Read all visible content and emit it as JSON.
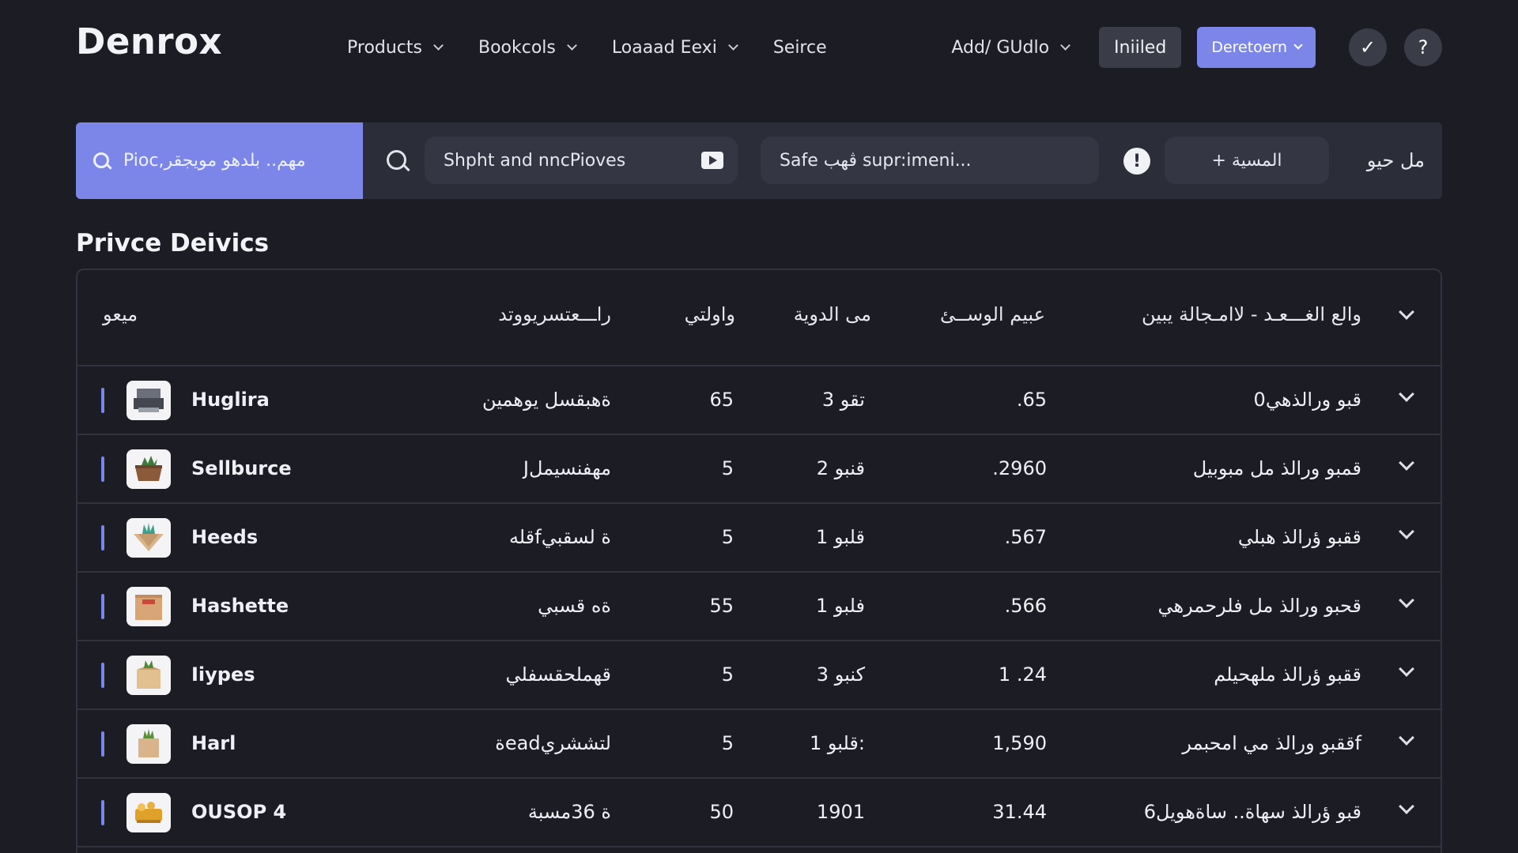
{
  "app": {
    "logo": "Denrox"
  },
  "nav": {
    "items": [
      {
        "label": "Products",
        "has_menu": true
      },
      {
        "label": "Bookcols",
        "has_menu": true
      },
      {
        "label": "Loaaad Eexi",
        "has_menu": true
      },
      {
        "label": "Seirce",
        "has_menu": false
      }
    ],
    "add_guide": "Add/ GUdlo",
    "inlined_button": "Iniiled",
    "deretoern_button": "Deretoern"
  },
  "search": {
    "primary_placeholder": "Pioc,مهم.. بلدهو مويجقر",
    "pill1_text": "Shpht and nncPioves",
    "pill2_text": "Safe ڤهب supr:imeni...",
    "alert_glyph": "!",
    "pill3_text": "المسية +",
    "right_text": "مل حيو"
  },
  "section": {
    "title": "Privce Deivics"
  },
  "table": {
    "headers": {
      "name": "ميعو",
      "desc": "راـــعتسريووتد",
      "qty": "واولتي",
      "group": "مى الدوية",
      "price": "عبيم الوســئ",
      "detail": "والع الغـــعـد - لاامـجالة يبين"
    },
    "rows": [
      {
        "name": "Huglira",
        "desc": "ةهبقسل يوهمين",
        "qty": "65",
        "group": "تقو 3",
        "price": ".65",
        "detail": "0قبو ورالذهي"
      },
      {
        "name": "Sellburce",
        "desc": "Jمهفنسيمل",
        "qty": "5",
        "group": "قنبو 2",
        "price": ".2960",
        "detail": "قمبو ورالذ مل مبوبيل"
      },
      {
        "name": "Heeds",
        "desc": "قلهfة لسقبي",
        "qty": "5",
        "group": "قلبو 1",
        "price": ".567",
        "detail": "ققبو ؤرالذ هبلي"
      },
      {
        "name": "Hashette",
        "desc": "ةه قسبي",
        "qty": "55",
        "group": "فلبو 1",
        "price": ".566",
        "detail": "قحبو ورالذ مل فلرحمرهي"
      },
      {
        "name": "Iiypes",
        "desc": "قهملحقسفلي",
        "qty": "5",
        "group": "كنبو 3",
        "price": "1 .24",
        "detail": "ققبو ؤرالذ ملهحيلم"
      },
      {
        "name": "Harl",
        "desc": "ةeadلتششري",
        "qty": "5",
        "group": "قلبو 1:",
        "price": "1,590",
        "detail": "ققبو ورالذ مي امحبمرf"
      },
      {
        "name": "OUSOP 4",
        "desc": "ة 36مسبة",
        "qty": "50",
        "group": "1901",
        "price": "31.44",
        "detail": "6قبو ؤرالذ سهاة.. ساةهويل"
      }
    ]
  },
  "colors": {
    "accent": "#7c85e8",
    "background": "#1c1d24",
    "surface": "#2b2d38"
  },
  "icons": [
    "search-icon",
    "play-icon",
    "alert-icon",
    "check-icon",
    "help-icon",
    "chevron-down-icon"
  ]
}
